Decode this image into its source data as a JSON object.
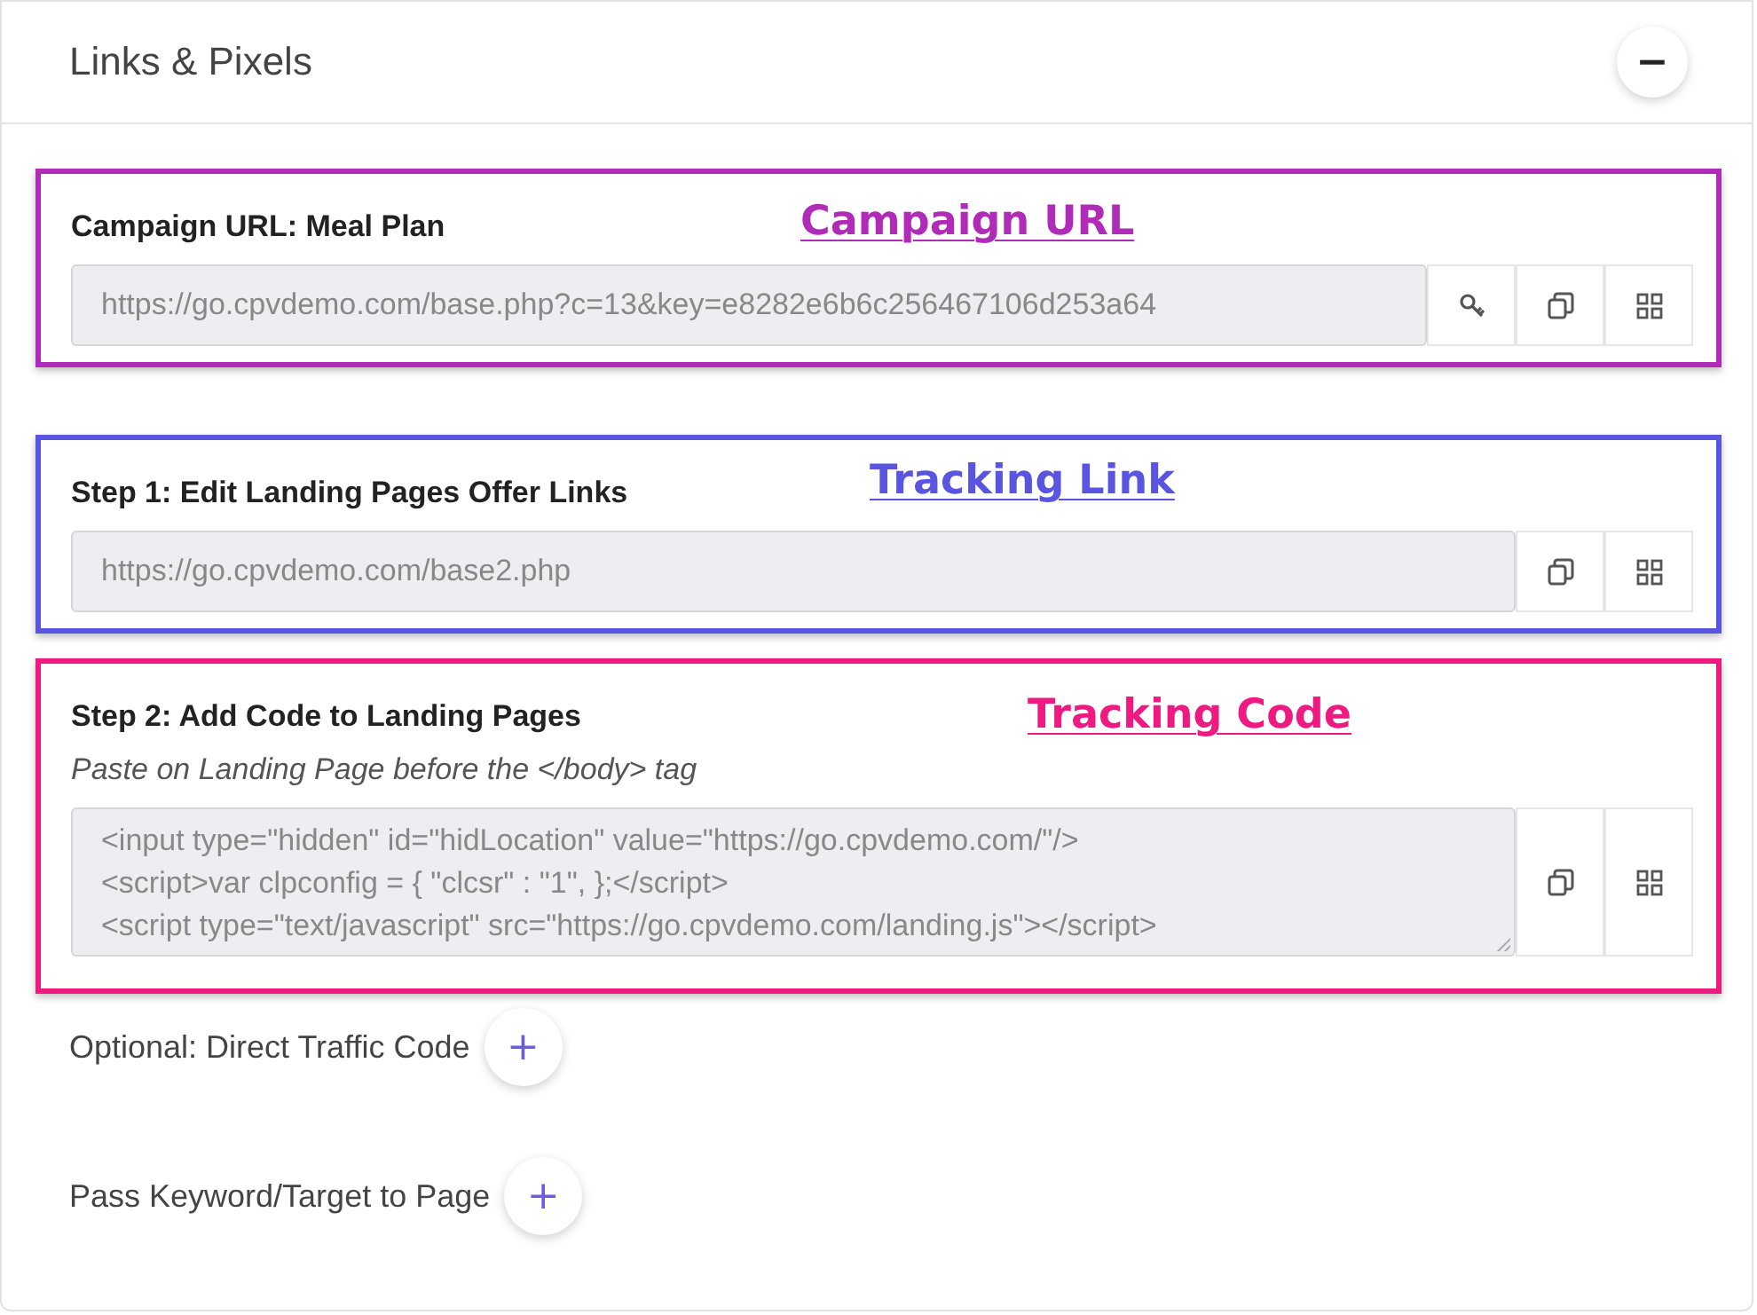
{
  "panel": {
    "title": "Links & Pixels",
    "collapse_button": "−"
  },
  "sections": [
    {
      "label": "Campaign URL: Meal Plan",
      "annotation": "Campaign URL",
      "color": "#b02cb8",
      "value": "https://go.cpvdemo.com/base.php?c=13&key=e8282e6b6c256467106d253a64",
      "buttons": [
        {
          "kind": "key"
        },
        {
          "kind": "copy"
        },
        {
          "kind": "qr"
        }
      ]
    },
    {
      "label": "Step 1: Edit Landing Pages Offer Links",
      "annotation": "Tracking Link",
      "color": "#5a55e0",
      "value": "https://go.cpvdemo.com/base2.php",
      "buttons": [
        {
          "kind": "copy"
        },
        {
          "kind": "qr"
        }
      ]
    },
    {
      "label": "Step 2: Add Code to Landing Pages",
      "annotation": "Tracking Code",
      "color": "#ee1a82",
      "hint": "Paste on Landing Page before the </body> tag",
      "lines": [
        "<input type=\"hidden\" id=\"hidLocation\" value=\"https://go.cpvdemo.com/\"/>",
        "<script>var clpconfig = { \"clcsr\" : \"1\", };</script>",
        "<script type=\"text/javascript\" src=\"https://go.cpvdemo.com/landing.js\"></script>"
      ],
      "buttons": [
        {
          "kind": "copy"
        },
        {
          "kind": "qr"
        }
      ]
    }
  ],
  "options": [
    {
      "label": "Optional: Direct Traffic Code",
      "button": "+"
    },
    {
      "label": "Pass Keyword/Target to Page",
      "button": "+"
    }
  ]
}
